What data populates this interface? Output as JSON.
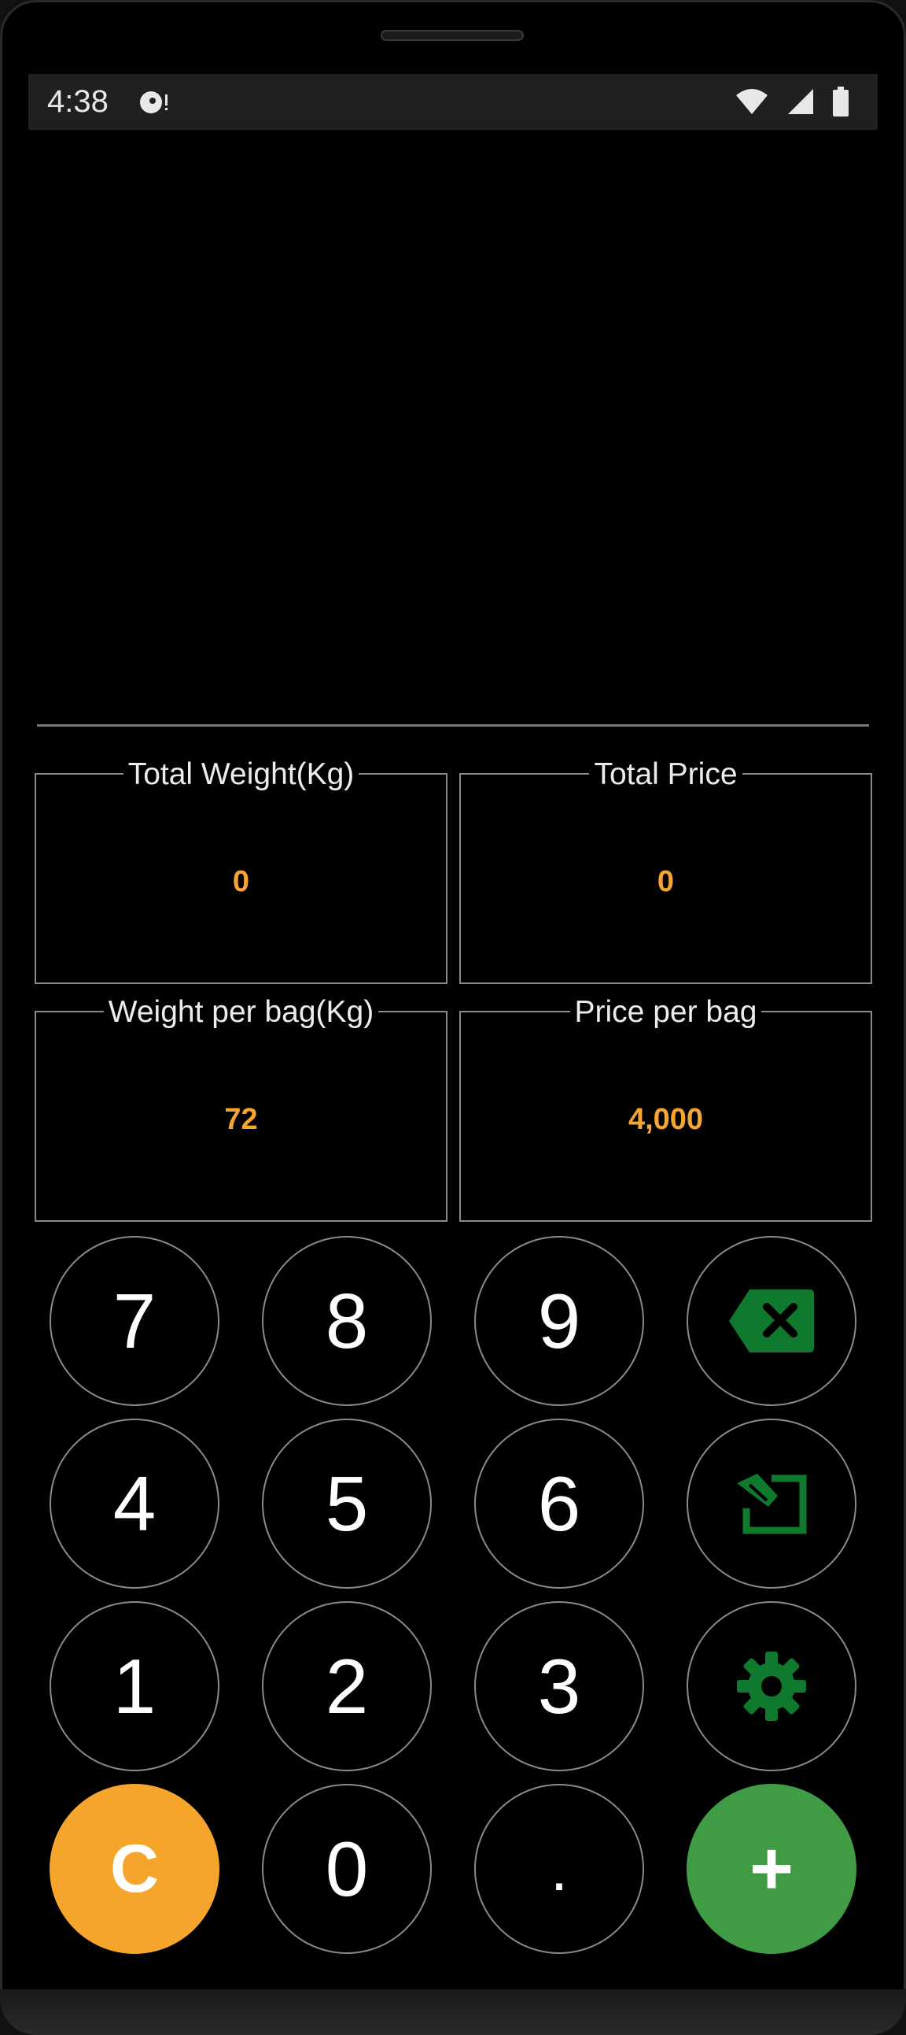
{
  "status": {
    "time": "4:38"
  },
  "cards": {
    "total_weight": {
      "title": "Total Weight(Kg)",
      "value": "0"
    },
    "total_price": {
      "title": "Total Price",
      "value": "0"
    },
    "weight_per_bag": {
      "title": "Weight per bag(Kg)",
      "value": "72"
    },
    "price_per_bag": {
      "title": "Price per bag",
      "value": "4,000"
    }
  },
  "keypad": {
    "k7": "7",
    "k8": "8",
    "k9": "9",
    "k4": "4",
    "k5": "5",
    "k6": "6",
    "k1": "1",
    "k2": "2",
    "k3": "3",
    "clear": "C",
    "k0": "0",
    "dot": ".",
    "add": "+"
  },
  "colors": {
    "accent": "#f6a530",
    "icon_green": "#0f7a2e",
    "add_green": "#3f9c45",
    "clear_orange": "#f6a52c"
  },
  "icons": [
    "backspace-icon",
    "edit-icon",
    "gear-icon"
  ]
}
